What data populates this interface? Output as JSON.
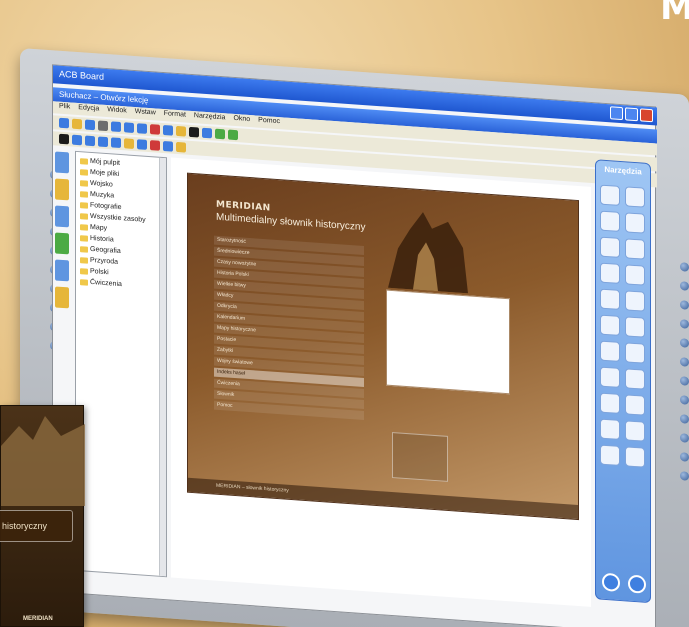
{
  "corner_logo": "M",
  "board": {
    "outer_window_title": "ACB Board",
    "inner_window_title": "Słuchacz – Otwórz lekcję",
    "menu_items": [
      "Plik",
      "Edycja",
      "Widok",
      "Wstaw",
      "Format",
      "Narzędzia",
      "Okno",
      "Pomoc"
    ]
  },
  "tree": {
    "items": [
      "Mój pulpit",
      "Moje pliki",
      "Wojsko",
      "Muzyka",
      "Fotografie",
      "Wszystkie zasoby",
      "Mapy",
      "Historia",
      "Geografia",
      "Przyroda",
      "Polski",
      "Ćwiczenia"
    ]
  },
  "meridian": {
    "brand": "MERIDIAN",
    "title": "Multimedialny słownik historyczny",
    "menu_rows": [
      "Starożytność",
      "Średniowiecze",
      "Czasy nowożytne",
      "Historia Polski",
      "Wielkie bitwy",
      "Władcy",
      "Odkrycia",
      "Kalendarium",
      "Mapy historyczne",
      "Postacie",
      "Zabytki",
      "Wojny światowe",
      "Indeks haseł",
      "Ćwiczenia",
      "Słownik",
      "Pomoc"
    ],
    "highlighted_row_index": 12,
    "footer": "MERIDIAN – słownik historyczny"
  },
  "palette": {
    "title": "Narzędzia",
    "tools": [
      "arrow-icon",
      "pen-icon",
      "highlighter-icon",
      "marker-icon",
      "brush-icon",
      "eraser-icon",
      "line-icon",
      "shape-icon",
      "image-icon",
      "triangle-icon",
      "color-icon",
      "chart-icon",
      "text-icon",
      "ruler-icon",
      "fill-icon",
      "magnifier-icon",
      "spotlight-icon",
      "camera-icon",
      "undo-icon",
      "redo-icon",
      "screen-icon",
      "print-icon"
    ]
  },
  "product_box": {
    "label": "historyczny",
    "brand": "MERIDIAN"
  },
  "colors": {
    "xp_blue": "#2a62d8",
    "meridian_brown": "#6a3e1e",
    "palette_blue": "#5f95e0"
  }
}
